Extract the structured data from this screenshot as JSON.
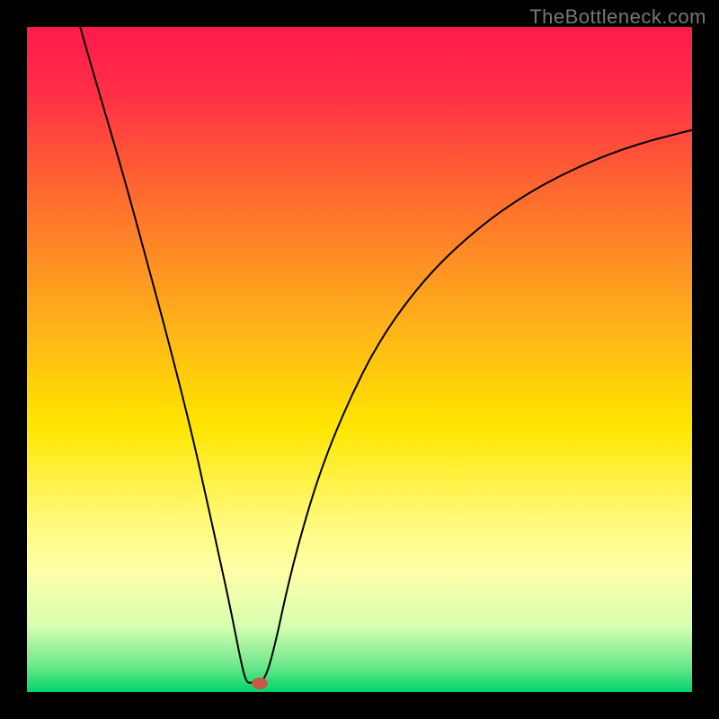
{
  "watermark": "TheBottleneck.com",
  "chart_data": {
    "type": "line",
    "title": "",
    "xlabel": "",
    "ylabel": "",
    "xlim": [
      0,
      100
    ],
    "ylim": [
      0,
      100
    ],
    "background_gradient": {
      "stops": [
        {
          "offset": 0.0,
          "color": "#ff1a4b"
        },
        {
          "offset": 0.1,
          "color": "#ff2f46"
        },
        {
          "offset": 0.25,
          "color": "#ff6a2f"
        },
        {
          "offset": 0.45,
          "color": "#ffb21a"
        },
        {
          "offset": 0.6,
          "color": "#ffe600"
        },
        {
          "offset": 0.75,
          "color": "#fffb80"
        },
        {
          "offset": 0.82,
          "color": "#fdffa8"
        },
        {
          "offset": 0.9,
          "color": "#d8ffb0"
        },
        {
          "offset": 0.96,
          "color": "#6fe88c"
        },
        {
          "offset": 1.0,
          "color": "#00d46a"
        }
      ]
    },
    "series": [
      {
        "name": "curve",
        "stroke": "#000000",
        "stroke_width": 2,
        "points": [
          {
            "x": 8.0,
            "y": 100.0
          },
          {
            "x": 10.0,
            "y": 93.0
          },
          {
            "x": 14.0,
            "y": 79.5
          },
          {
            "x": 18.0,
            "y": 65.0
          },
          {
            "x": 22.0,
            "y": 50.0
          },
          {
            "x": 25.0,
            "y": 38.0
          },
          {
            "x": 27.0,
            "y": 29.0
          },
          {
            "x": 29.0,
            "y": 20.0
          },
          {
            "x": 30.5,
            "y": 13.0
          },
          {
            "x": 31.5,
            "y": 8.0
          },
          {
            "x": 32.3,
            "y": 4.0
          },
          {
            "x": 33.0,
            "y": 1.4
          },
          {
            "x": 33.8,
            "y": 1.4
          },
          {
            "x": 35.2,
            "y": 1.4
          },
          {
            "x": 36.2,
            "y": 3.0
          },
          {
            "x": 37.5,
            "y": 8.0
          },
          {
            "x": 39.0,
            "y": 15.0
          },
          {
            "x": 41.0,
            "y": 23.0
          },
          {
            "x": 44.0,
            "y": 33.0
          },
          {
            "x": 48.0,
            "y": 43.0
          },
          {
            "x": 53.0,
            "y": 53.0
          },
          {
            "x": 60.0,
            "y": 62.5
          },
          {
            "x": 68.0,
            "y": 70.0
          },
          {
            "x": 76.0,
            "y": 75.5
          },
          {
            "x": 84.0,
            "y": 79.5
          },
          {
            "x": 92.0,
            "y": 82.5
          },
          {
            "x": 100.0,
            "y": 84.5
          }
        ]
      }
    ],
    "marker": {
      "name": "minimum-marker",
      "x": 35.0,
      "y": 1.3,
      "rx": 1.2,
      "ry": 0.9,
      "fill": "#c65a4a"
    }
  }
}
